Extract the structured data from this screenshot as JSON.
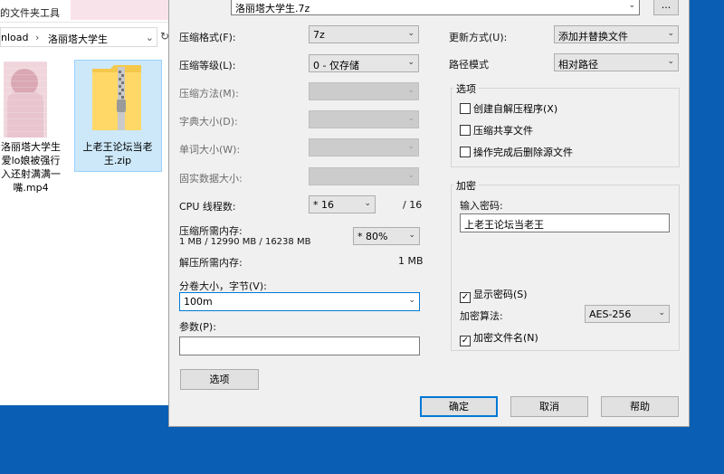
{
  "explorer": {
    "tab_title": "的文件夹工具",
    "address": {
      "segment1": "nload",
      "segment2": "洛丽塔大学生"
    },
    "files": [
      {
        "lines": [
          "洛丽塔大学生",
          "爱lo娘被强行",
          "入还射满满一",
          "嘴.mp4"
        ]
      },
      {
        "lines": [
          "上老王论坛当老",
          "王.zip"
        ]
      }
    ]
  },
  "dialog": {
    "archive_name": "洛丽塔大学生.7z",
    "browse_label": "...",
    "left": {
      "format_label": "压缩格式(F):",
      "format_value": "7z",
      "level_label": "压缩等级(L):",
      "level_value": "0 - 仅存储",
      "method_label": "压缩方法(M):",
      "dict_label": "字典大小(D):",
      "word_label": "单词大小(W):",
      "solid_label": "固实数据大小:",
      "threads_label": "CPU 线程数:",
      "threads_value": "16",
      "threads_total": "/ 16",
      "mem_label": "压缩所需内存:",
      "mem_value": "1 MB / 12990 MB / 16238 MB",
      "mem_percent": "80%",
      "decomp_label": "解压所需内存:",
      "decomp_value": "1 MB",
      "split_label": "分卷大小，字节(V):",
      "split_value": "100m",
      "params_label": "参数(P):",
      "params_value": "",
      "options_button": "选项"
    },
    "right": {
      "update_label": "更新方式(U):",
      "update_value": "添加并替换文件",
      "path_label": "路径模式",
      "path_value": "相对路径",
      "options_group": "选项",
      "opt_sfx": "创建自解压程序(X)",
      "opt_shared": "压缩共享文件",
      "opt_delete": "操作完成后删除源文件",
      "encrypt_group": "加密",
      "password_label": "输入密码:",
      "password_value": "上老王论坛当老王",
      "show_password": "显示密码(S)",
      "algo_label": "加密算法:",
      "algo_value": "AES-256",
      "encrypt_names": "加密文件名(N)"
    },
    "buttons": {
      "ok": "确定",
      "cancel": "取消",
      "help": "帮助"
    }
  }
}
